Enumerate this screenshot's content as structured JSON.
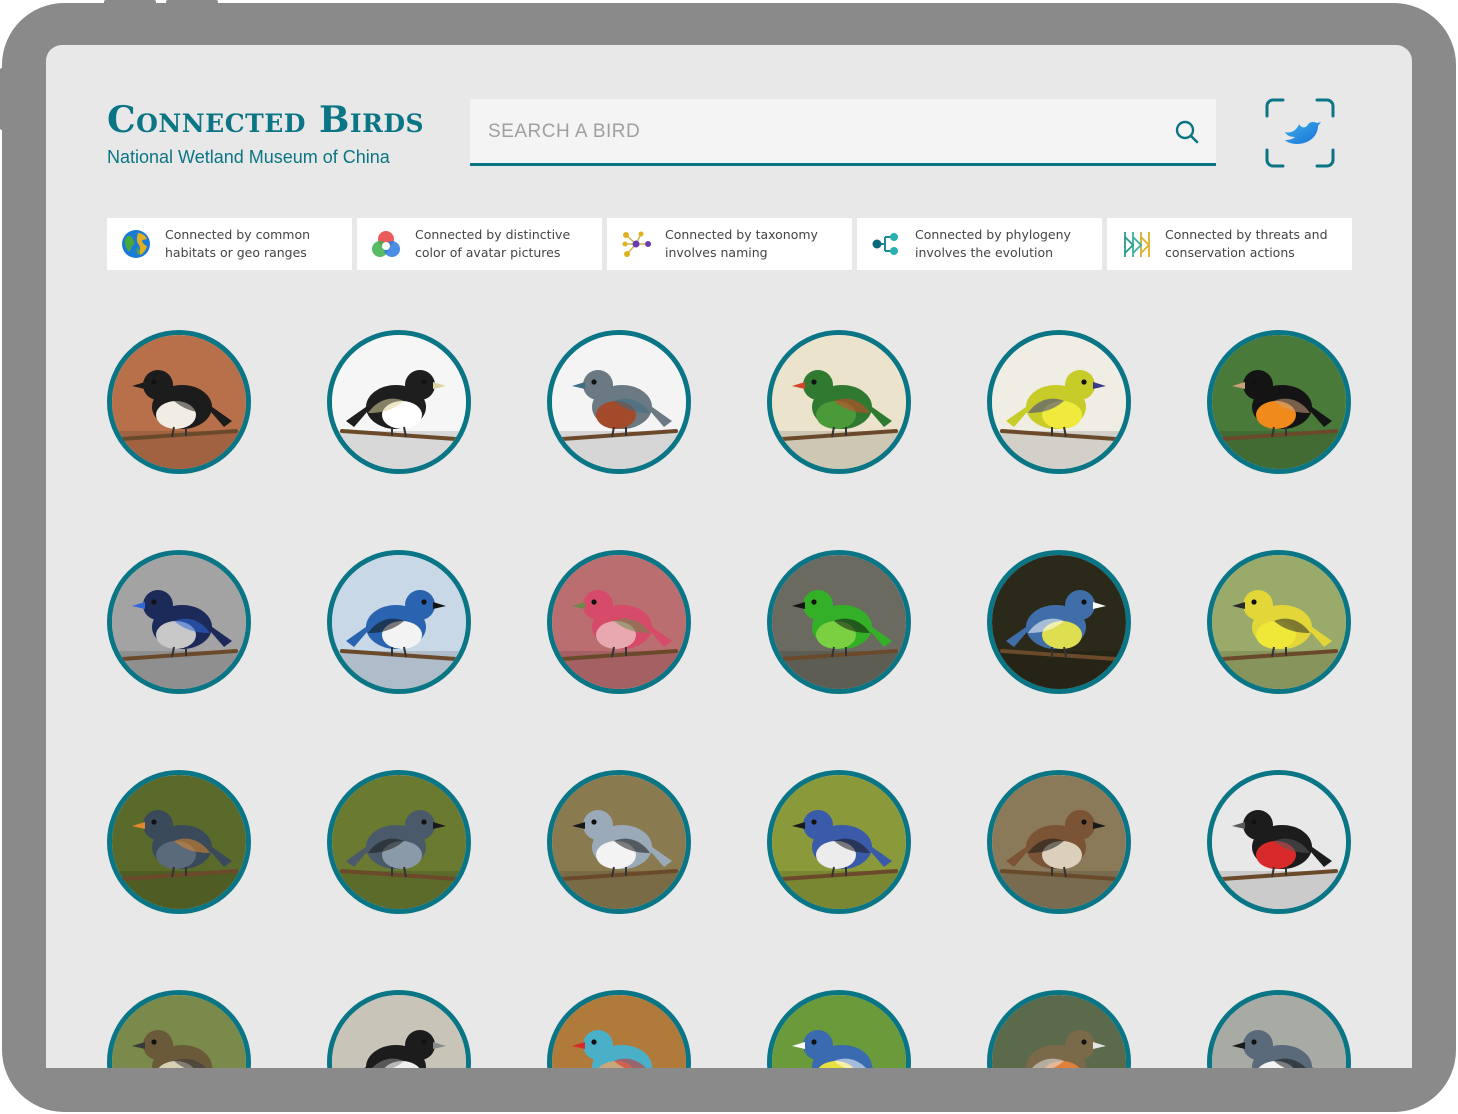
{
  "app": {
    "title": "Connected Birds",
    "subtitle": "National Wetland Museum of China"
  },
  "search": {
    "placeholder": "SEARCH A BIRD",
    "value": "",
    "icon": "search-icon"
  },
  "scan_button": {
    "icon": "bird-scan-icon"
  },
  "filters": [
    {
      "label": "Connected by common\nhabitats or geo ranges",
      "icon": "globe-icon"
    },
    {
      "label": "Connected by distinctive\ncolor of avatar pictures",
      "icon": "color-wheel-icon"
    },
    {
      "label": "Connected by taxonomy\ninvolves naming",
      "icon": "network-icon"
    },
    {
      "label": "Connected by phylogeny\ninvolves the evolution",
      "icon": "phylogeny-icon"
    },
    {
      "label": "Connected by threats and\nconservation actions",
      "icon": "threats-icon"
    }
  ],
  "colors": {
    "accent": "#0a7584",
    "frame": "#8a8a8a",
    "screen": "#e8e8e8"
  },
  "birds": [
    {
      "bg": "#b8704a",
      "fg": "#1c1c1c",
      "belly": "#f2ede4",
      "accent": "#1c1c1c"
    },
    {
      "bg": "#f6f6f6",
      "fg": "#1e1e1e",
      "belly": "#ffffff",
      "accent": "#dcd3a0"
    },
    {
      "bg": "#f4f4f4",
      "fg": "#6b7a82",
      "belly": "#a34a2a",
      "accent": "#3e6c82"
    },
    {
      "bg": "#ebe3cc",
      "fg": "#2f7a30",
      "belly": "#4a9a3a",
      "accent": "#d8422a"
    },
    {
      "bg": "#efede4",
      "fg": "#c8cc28",
      "belly": "#f0ea3c",
      "accent": "#3a3a8a"
    },
    {
      "bg": "#4a7a3a",
      "fg": "#141414",
      "belly": "#f08a1a",
      "accent": "#c9a07a"
    },
    {
      "bg": "#a3a3a3",
      "fg": "#1c2a5a",
      "belly": "#c8c8c8",
      "accent": "#2f68d8"
    },
    {
      "bg": "#c8d8e6",
      "fg": "#2a64b0",
      "belly": "#f3f3f3",
      "accent": "#121212"
    },
    {
      "bg": "#bb6e70",
      "fg": "#d64a6a",
      "belly": "#e8a8b0",
      "accent": "#6a8a4a"
    },
    {
      "bg": "#6a6a60",
      "fg": "#34b028",
      "belly": "#7ad040",
      "accent": "#141414"
    },
    {
      "bg": "#2b2a1a",
      "fg": "#3f6ea8",
      "belly": "#dede50",
      "accent": "#ffffff"
    },
    {
      "bg": "#9aaa6a",
      "fg": "#e2d638",
      "belly": "#f0e838",
      "accent": "#2a2a2a"
    },
    {
      "bg": "#5a6a2a",
      "fg": "#3a4a5a",
      "belly": "#5a6a7a",
      "accent": "#e0882a"
    },
    {
      "bg": "#6a7a30",
      "fg": "#4a5a6a",
      "belly": "#8a9aa8",
      "accent": "#1a1a1a"
    },
    {
      "bg": "#8a7a50",
      "fg": "#9aaab8",
      "belly": "#f3f3f3",
      "accent": "#1a1a1a"
    },
    {
      "bg": "#8a9a3a",
      "fg": "#3a5aaa",
      "belly": "#ececec",
      "accent": "#1a1a1a"
    },
    {
      "bg": "#8a7a5a",
      "fg": "#7a5434",
      "belly": "#dcd0bc",
      "accent": "#1a1a1a"
    },
    {
      "bg": "#e8e8e8",
      "fg": "#1c1c1c",
      "belly": "#d82a2a",
      "accent": "#5a5a5a"
    },
    {
      "bg": "#7a8a4a",
      "fg": "#6a5a3a",
      "belly": "#d8d0b4",
      "accent": "#3a3a3a"
    },
    {
      "bg": "#c8c4b8",
      "fg": "#1c1c1c",
      "belly": "#f0f0f0",
      "accent": "#8a8a8a"
    },
    {
      "bg": "#b07a3a",
      "fg": "#4ab0c8",
      "belly": "#c8a87a",
      "accent": "#d82a2a"
    },
    {
      "bg": "#6a9a3a",
      "fg": "#3a6ab0",
      "belly": "#e8e040",
      "accent": "#ffffff"
    },
    {
      "bg": "#5a6a4a",
      "fg": "#7a6a4a",
      "belly": "#e0803a",
      "accent": "#e6e6e6"
    },
    {
      "bg": "#a8aaa4",
      "fg": "#5a6a7a",
      "belly": "#f3f3f3",
      "accent": "#1a1a1a"
    }
  ]
}
